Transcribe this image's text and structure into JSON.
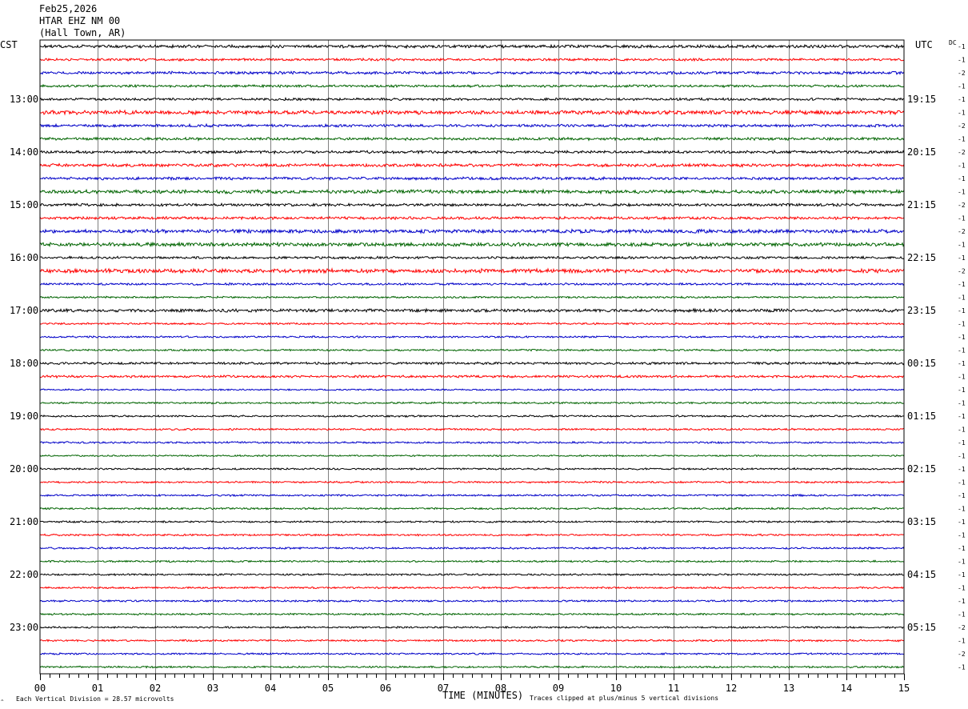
{
  "header": {
    "date": "Feb25,2026",
    "station": "HTAR EHZ NM 00",
    "location": "(Hall Town, AR)"
  },
  "left_zone_label": "CST",
  "right_zone_label": "UTC",
  "dc_header": "DC",
  "footer": {
    "scale_note": "Each Vertical Division =   28.57 microvolts",
    "x_axis_title": "TIME (MINUTES)",
    "clip_note": "Traces clipped at plus/minus 5 vertical divisions"
  },
  "colors": {
    "trace_cycle": [
      "#000000",
      "#ff0000",
      "#0000c8",
      "#006400"
    ],
    "gridline": "#808080",
    "frame": "#000000",
    "background": "#ffffff"
  },
  "chart_data": {
    "type": "line",
    "title": "",
    "xlabel": "TIME (MINUTES)",
    "ylabel": "",
    "xlim": [
      0,
      15
    ],
    "x_ticks": [
      "00",
      "01",
      "02",
      "03",
      "04",
      "05",
      "06",
      "07",
      "08",
      "09",
      "10",
      "11",
      "12",
      "13",
      "14",
      "15"
    ],
    "rows_count": 48,
    "minutes_per_row": 15,
    "left_hour_labels": [
      "13:00",
      "14:00",
      "15:00",
      "16:00",
      "17:00",
      "18:00",
      "19:00",
      "20:00",
      "21:00",
      "22:00",
      "23:00"
    ],
    "right_hour_labels": [
      "19:15",
      "20:15",
      "21:15",
      "22:15",
      "23:15",
      "00:15",
      "01:15",
      "02:15",
      "03:15",
      "04:15",
      "05:15"
    ],
    "dc_offsets": [
      -1,
      -1,
      -2,
      -1,
      -1,
      -1,
      -2,
      -1,
      -2,
      -1,
      -1,
      -1,
      -2,
      -1,
      -2,
      -1,
      -1,
      -2,
      -1,
      -1,
      -1,
      -1,
      -1,
      -1,
      -1,
      -1,
      -1,
      -1,
      -1,
      -1,
      -1,
      -1,
      -1,
      -1,
      -1,
      -1,
      -1,
      -1,
      -1,
      -1,
      -1,
      -1,
      -1,
      -1,
      -2,
      -1,
      -2,
      -1
    ],
    "series": [
      {
        "name": "EHZ",
        "amplitude_divisions": [
          1.0,
          0.8,
          0.9,
          0.8,
          0.8,
          1.3,
          0.9,
          0.9,
          0.9,
          1.0,
          0.9,
          1.2,
          0.9,
          0.9,
          1.2,
          1.2,
          0.8,
          1.3,
          0.7,
          0.6,
          1.0,
          0.6,
          0.6,
          0.6,
          0.8,
          0.8,
          0.5,
          0.6,
          0.6,
          0.6,
          0.6,
          0.5,
          0.6,
          0.6,
          0.6,
          0.6,
          0.6,
          0.6,
          0.6,
          0.6,
          0.6,
          0.6,
          0.6,
          0.6,
          0.6,
          0.6,
          0.6,
          0.6
        ]
      }
    ]
  }
}
